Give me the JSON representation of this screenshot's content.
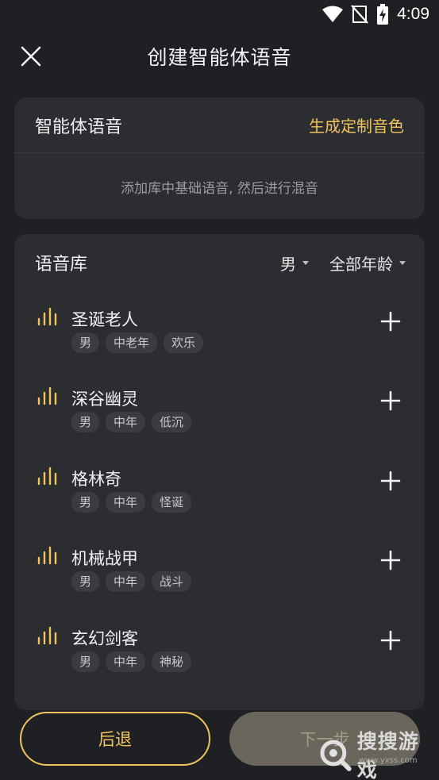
{
  "status": {
    "time": "4:09"
  },
  "header": {
    "title": "创建智能体语音"
  },
  "voice_card": {
    "title": "智能体语音",
    "custom_link": "生成定制音色",
    "hint": "添加库中基础语音, 然后进行混音"
  },
  "library": {
    "title": "语音库",
    "filter_gender": "男",
    "filter_age": "全部年龄",
    "items": [
      {
        "name": "圣诞老人",
        "tags": [
          "男",
          "中老年",
          "欢乐"
        ]
      },
      {
        "name": "深谷幽灵",
        "tags": [
          "男",
          "中年",
          "低沉"
        ]
      },
      {
        "name": "格林奇",
        "tags": [
          "男",
          "中年",
          "怪诞"
        ]
      },
      {
        "name": "机械战甲",
        "tags": [
          "男",
          "中年",
          "战斗"
        ]
      },
      {
        "name": "玄幻剑客",
        "tags": [
          "男",
          "中年",
          "神秘"
        ]
      }
    ]
  },
  "footer": {
    "back_label": "后退",
    "next_label": "下一步"
  },
  "watermark": {
    "text": "搜搜游戏",
    "sub": "www.yxss.com"
  },
  "colors": {
    "accent": "#f1c45a",
    "background": "#1f2023",
    "card": "#2c2d31"
  }
}
